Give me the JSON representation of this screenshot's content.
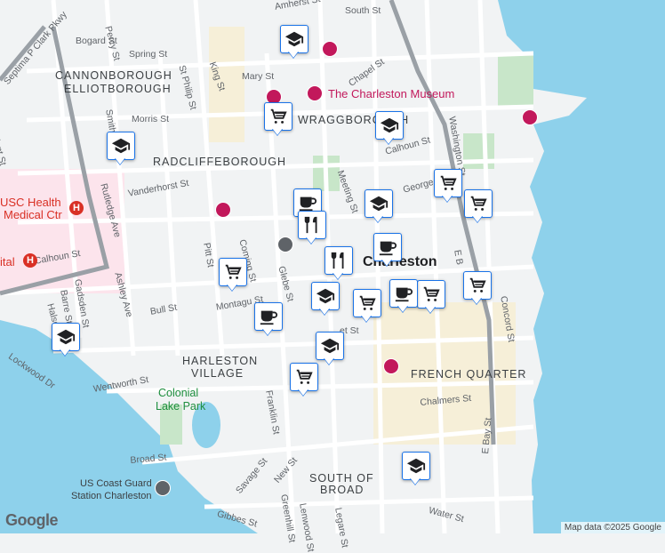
{
  "map": {
    "water_color": "#8ed1eb",
    "land_color": "#f1f3f4",
    "park_color": "#c8e6c9",
    "medical_color": "#fce4ec",
    "highway_color": "#9aa0a6"
  },
  "labels": {
    "streets": [
      "Bogard St",
      "Percy St",
      "Spring St",
      "Septima P Clark Pkwy",
      "King St",
      "Mary St",
      "St Philip St",
      "Smith St",
      "Morris St",
      "Chapel St",
      "Calhoun St",
      "Washington St",
      "Rutledge Ave",
      "Vanderhorst St",
      "George St",
      "Meeting St",
      "Pitt St",
      "Coming St",
      "Glebe St",
      "Bull St",
      "Montagu St",
      "Gadsden St",
      "Barre St",
      "Ashley Ave",
      "Halsey St",
      "Lockwood Dr",
      "Wentworth St",
      "Franklin St",
      "Broad St",
      "Savage St",
      "New St",
      "Greenhill St",
      "Lenwood St",
      "Legare St",
      "Gibbes St",
      "Chalmers St",
      "Water St",
      "E Bay St",
      "Concord St",
      "South St",
      "Amherst St",
      "Calhoun St"
    ],
    "neighborhoods": [
      "CANNONBOROUGH",
      "ELLIOTBOROUGH",
      "RADCLIFFEBOROUGH",
      "WRAGGBOROUGH",
      "HARLESTON",
      "VILLAGE",
      "FRENCH QUARTER",
      "SOUTH OF",
      "BROAD"
    ],
    "city": "Charleston",
    "parks": [
      "Colonial",
      "Lake Park"
    ],
    "pois": [
      "The Charleston Museum",
      "MUSC Health",
      "Medical Ctr",
      "US Coast Guard",
      "Station Charleston",
      "Hospital"
    ],
    "fragment_ident": "ident St",
    "fragment_ital": "ital",
    "fragment_et": "et St",
    "fragment_usc": "USC Health",
    "fragment_e_b": "E B"
  },
  "markers": [
    {
      "type": "school",
      "name": "school-marker"
    },
    {
      "type": "school",
      "name": "school-marker"
    },
    {
      "type": "school",
      "name": "school-marker"
    },
    {
      "type": "school",
      "name": "school-marker"
    },
    {
      "type": "school",
      "name": "school-marker"
    },
    {
      "type": "school",
      "name": "school-marker"
    },
    {
      "type": "school",
      "name": "school-marker"
    },
    {
      "type": "school",
      "name": "school-marker"
    },
    {
      "type": "shop",
      "name": "grocery-marker"
    },
    {
      "type": "shop",
      "name": "grocery-marker"
    },
    {
      "type": "shop",
      "name": "grocery-marker"
    },
    {
      "type": "shop",
      "name": "grocery-marker"
    },
    {
      "type": "shop",
      "name": "grocery-marker"
    },
    {
      "type": "shop",
      "name": "grocery-marker"
    },
    {
      "type": "shop",
      "name": "grocery-marker"
    },
    {
      "type": "shop",
      "name": "grocery-marker"
    },
    {
      "type": "cafe",
      "name": "cafe-marker"
    },
    {
      "type": "cafe",
      "name": "cafe-marker"
    },
    {
      "type": "cafe",
      "name": "cafe-marker"
    },
    {
      "type": "cafe",
      "name": "cafe-marker"
    },
    {
      "type": "restaurant",
      "name": "restaurant-marker"
    },
    {
      "type": "restaurant",
      "name": "restaurant-marker"
    }
  ],
  "footer": {
    "attribution": "Map data ©2025 Google",
    "logo": "Google"
  }
}
